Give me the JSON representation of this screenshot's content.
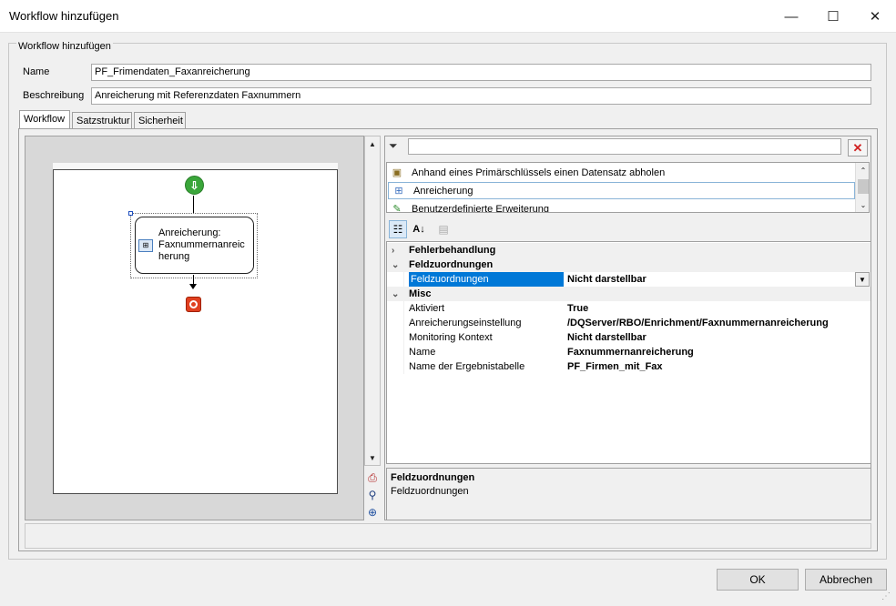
{
  "window": {
    "title": "Workflow hinzufügen",
    "controls": {
      "minimize": "—",
      "maximize": "☐",
      "close": "✕"
    }
  },
  "group": {
    "title": "Workflow hinzufügen"
  },
  "form": {
    "name_label": "Name",
    "name_value": "PF_Frimendaten_Faxanreicherung",
    "desc_label": "Beschreibung",
    "desc_value": "Anreicherung mit Referenzdaten Faxnummern"
  },
  "tabs": [
    {
      "label": "Workflow",
      "active": true
    },
    {
      "label": "Satzstruktur",
      "active": false
    },
    {
      "label": "Sicherheit",
      "active": false
    }
  ],
  "workflow": {
    "node_label_1": "Anreicherung:",
    "node_label_2": "Faxnummernanreic",
    "node_label_3": "herung",
    "start_icon": "green-start-arrow-icon",
    "end_icon": "red-stop-icon"
  },
  "filter": {
    "value": ""
  },
  "activities": [
    {
      "label": "Anhand eines Primärschlüssels einen Datensatz abholen",
      "icon": "record-icon"
    },
    {
      "label": "Anreicherung",
      "icon": "enrichment-icon",
      "selected": true
    },
    {
      "label": "Benutzerdefinierte Erweiterung",
      "icon": "custom-extension-icon"
    }
  ],
  "properties": {
    "categories": [
      {
        "name": "Fehlerbehandlung",
        "expanded": false,
        "items": []
      },
      {
        "name": "Feldzuordnungen",
        "expanded": true,
        "items": [
          {
            "name": "Feldzuordnungen",
            "value": "Nicht darstellbar",
            "selected": true
          }
        ]
      },
      {
        "name": "Misc",
        "expanded": true,
        "items": [
          {
            "name": "Aktiviert",
            "value": "True"
          },
          {
            "name": "Anreicherungseinstellung",
            "value": "/DQServer/RBO/Enrichment/Faxnummernanreicherung"
          },
          {
            "name": "Monitoring Kontext",
            "value": "Nicht darstellbar"
          },
          {
            "name": "Name",
            "value": "Faxnummernanreicherung"
          },
          {
            "name": "Name der Ergebnistabelle",
            "value": "PF_Firmen_mit_Fax"
          }
        ]
      }
    ]
  },
  "help": {
    "title": "Feldzuordnungen",
    "text": "Feldzuordnungen"
  },
  "buttons": {
    "ok": "OK",
    "cancel": "Abbrechen"
  },
  "colors": {
    "selection": "#0078d7",
    "start": "#3aa63a",
    "end": "#e04020"
  }
}
